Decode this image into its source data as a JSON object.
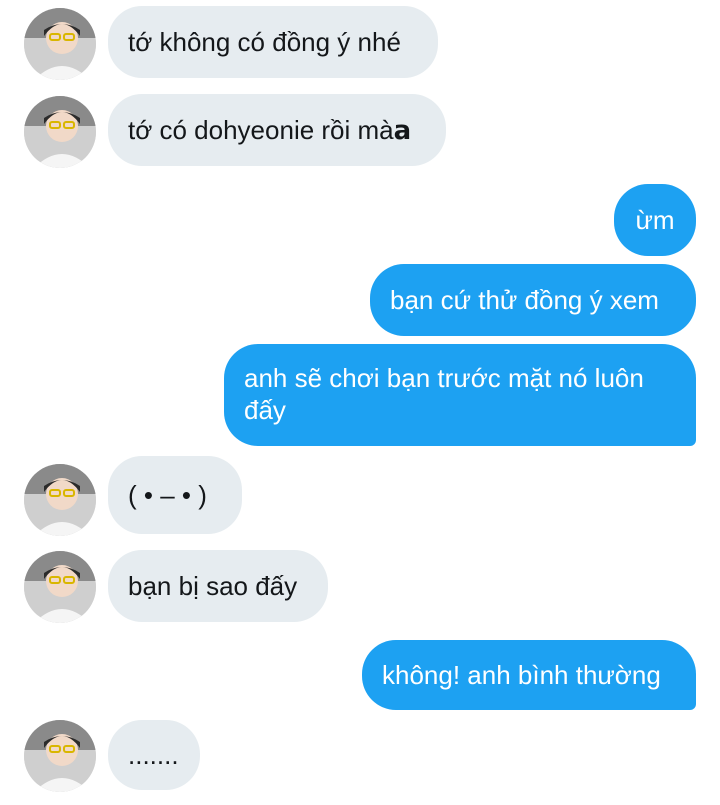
{
  "conversation": {
    "messages": [
      {
        "from": "other",
        "text": "tớ không có đồng ý nhé"
      },
      {
        "from": "other",
        "text": "tớ có dohyeonie rồi mà𝗮"
      },
      {
        "from": "me",
        "text": "ừm"
      },
      {
        "from": "me",
        "text": "bạn cứ thử đồng ý xem"
      },
      {
        "from": "me",
        "text": "anh sẽ chơi bạn trước mặt nó luôn đấy"
      },
      {
        "from": "other",
        "text": "( • – • )"
      },
      {
        "from": "other",
        "text": "bạn bị sao đấy"
      },
      {
        "from": "me",
        "text": "không! anh bình thường"
      },
      {
        "from": "other",
        "text": "......."
      }
    ]
  },
  "colors": {
    "incoming_bubble": "#e6ecf0",
    "outgoing_bubble": "#1da1f2",
    "incoming_text": "#14171a",
    "outgoing_text": "#ffffff"
  },
  "icons": {
    "avatar": "user-avatar-photo"
  }
}
